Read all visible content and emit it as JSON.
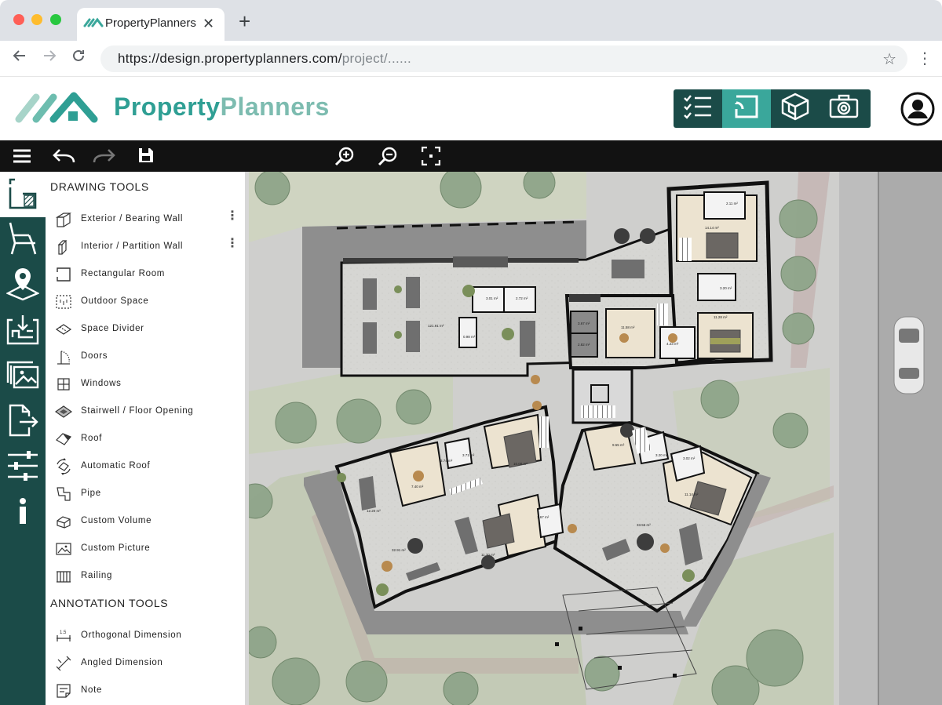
{
  "browser": {
    "tab_title": "PropertyPlanners",
    "tab_close": "✕",
    "new_tab": "+",
    "url_main": "https://design.propertyplanners.com/",
    "url_rest": "project/......"
  },
  "brand": {
    "name_part1": "Property",
    "name_part2": "Planners",
    "color_primary": "#2f9f94",
    "color_dark": "#1b4b48"
  },
  "view_switch": {
    "items": [
      {
        "icon": "checklist-icon"
      },
      {
        "icon": "floorplan-2d-icon"
      },
      {
        "icon": "cube-3d-icon"
      },
      {
        "icon": "camera-icon"
      }
    ],
    "active": "floorplan-2d-icon"
  },
  "toolbar": {
    "icons": [
      "menu-icon",
      "undo-icon",
      "redo-icon",
      "save-icon",
      "zoom-in-icon",
      "zoom-out-icon",
      "fit-screen-icon"
    ]
  },
  "rail": {
    "icons": [
      "drawing-tools-icon",
      "furniture-icon",
      "location-icon",
      "import-plan-icon",
      "images-icon",
      "export-icon",
      "settings-sliders-icon",
      "info-icon"
    ],
    "active": "drawing-tools-icon"
  },
  "panel": {
    "drawing_heading": "DRAWING TOOLS",
    "drawing_tools": [
      {
        "label": "Exterior / Bearing Wall",
        "more": "⋮"
      },
      {
        "label": "Interior / Partition Wall",
        "more": "⋮"
      },
      {
        "label": "Rectangular Room"
      },
      {
        "label": "Outdoor Space"
      },
      {
        "label": "Space Divider"
      },
      {
        "label": "Doors"
      },
      {
        "label": "Windows"
      },
      {
        "label": "Stairwell / Floor Opening"
      },
      {
        "label": "Roof"
      },
      {
        "label": "Automatic Roof"
      },
      {
        "label": "Pipe"
      },
      {
        "label": "Custom Volume"
      },
      {
        "label": "Custom Picture"
      },
      {
        "label": "Railing"
      }
    ],
    "annotation_heading": "ANNOTATION TOOLS",
    "annotation_tools": [
      {
        "label": "Orthogonal Dimension"
      },
      {
        "label": "Angled Dimension"
      },
      {
        "label": "Note"
      }
    ]
  },
  "floorplan": {
    "room_areas": [
      "3.01 m²",
      "2.72 m²",
      "121.91 m²",
      "0.98 m²",
      "14.14 m²",
      "2.11 m²",
      "3.20 m²",
      "11.28 m²",
      "11.58 m²",
      "4.23 m²",
      "3.67 m²",
      "2.82 m²",
      "9.55 m²",
      "3.20 m²",
      "3.02 m²",
      "11.14 m²",
      "33.56 m²",
      "10.00 m²",
      "3.74 m²",
      "3.71 m²",
      "7.40 m²",
      "12.20 m²",
      "1.67 m²",
      "11.70 m²",
      "32.91 m²"
    ],
    "dimension_mark": "1.5"
  }
}
